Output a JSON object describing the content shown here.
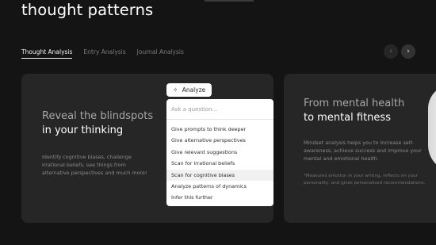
{
  "header": {
    "title": "thought patterns"
  },
  "tabs": [
    {
      "label": "Thought Analysis",
      "active": true
    },
    {
      "label": "Entry Analysis",
      "active": false
    },
    {
      "label": "Journal Analysis",
      "active": false
    }
  ],
  "nav": {
    "prev_icon": "‹",
    "next_icon": "›"
  },
  "cards": [
    {
      "heading_line1": "Reveal the blindspots",
      "heading_line2": "in your thinking",
      "body": "Identify cognitive biases, challenge irrational beliefs, see things from alternative perspectives and much more!"
    },
    {
      "heading_line1": "From mental health",
      "heading_line2": "to mental fitness",
      "body": "Mindset analysis helps you to increase self-awareness, achieve success and improve your mental and emotional health.",
      "note": "*Measures emotion in your writing, reflects on your personality, and gives personalised recommendations."
    }
  ],
  "analyze": {
    "button_label": "Analyze",
    "button_icon": "sparkle-icon",
    "input_placeholder": "Ask a question...",
    "options": [
      "Give prompts to think deeper",
      "Give alternative perspectives",
      "Give relevant suggestions",
      "Scan for irrational beliefs",
      "Scan for cognitive biases",
      "Analyze patterns of dynamics",
      "Infer this further"
    ],
    "hovered_index": 4
  },
  "colors": {
    "background": "#141414",
    "card": "#262626",
    "text_primary": "#ffffff",
    "text_muted": "#8a8a8a"
  }
}
